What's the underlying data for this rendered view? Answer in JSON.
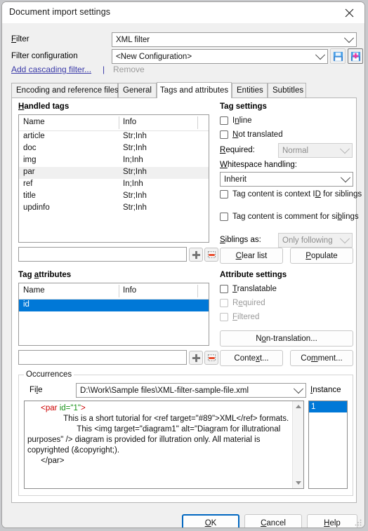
{
  "window": {
    "title": "Document import settings",
    "close_icon": "close-icon"
  },
  "top": {
    "filter_label": "Filter",
    "filter_value": "XML filter",
    "filter_config_label": "Filter configuration",
    "filter_config_value": "<New Configuration>",
    "save_config_icon": "save-configuration-icon",
    "save_as_new_config_icon": "save-as-new-configuration-icon",
    "add_cascading_filter": "Add cascading filter...",
    "separator": "|",
    "remove": "Remove"
  },
  "tabs": [
    {
      "label": "Encoding and reference files",
      "active": false
    },
    {
      "label": "General",
      "active": false
    },
    {
      "label": "Tags and attributes",
      "active": true
    },
    {
      "label": "Entities",
      "active": false
    },
    {
      "label": "Subtitles",
      "active": false
    }
  ],
  "handled_tags": {
    "title": "Handled tags",
    "columns": [
      "Name",
      "Info"
    ],
    "rows": [
      {
        "name": "article",
        "info": "Str;Inh",
        "state": "normal"
      },
      {
        "name": "doc",
        "info": "Str;Inh",
        "state": "normal"
      },
      {
        "name": "img",
        "info": "In;Inh",
        "state": "normal"
      },
      {
        "name": "par",
        "info": "Str;Inh",
        "state": "hover"
      },
      {
        "name": "ref",
        "info": "In;Inh",
        "state": "normal"
      },
      {
        "name": "title",
        "info": "Str;Inh",
        "state": "normal"
      },
      {
        "name": "updinfo",
        "info": "Str;Inh",
        "state": "normal"
      }
    ],
    "new_tag_value": "",
    "add_icon": "add-icon",
    "remove_icon": "remove-icon"
  },
  "tag_settings": {
    "title": "Tag settings",
    "inline_label": "Inline",
    "inline_checked": false,
    "not_translated_label": "Not translated",
    "not_translated_checked": false,
    "required_label": "Required:",
    "required_value": "Normal",
    "required_enabled": false,
    "whitespace_label": "Whitespace handling:",
    "whitespace_value": "Inherit",
    "context_id_label": "Tag content is context ID for siblings",
    "context_id_checked": false,
    "comment_label": "Tag content is comment for siblings",
    "comment_checked": false,
    "siblings_as_label": "Siblings as:",
    "siblings_as_value": "Only following",
    "siblings_as_enabled": false,
    "clear_list_button": "Clear list",
    "populate_button": "Populate"
  },
  "tag_attributes": {
    "title": "Tag attributes",
    "columns": [
      "Name",
      "Info"
    ],
    "rows": [
      {
        "name": "id",
        "info": "",
        "state": "selected"
      }
    ],
    "new_attr_value": "",
    "add_icon": "add-icon",
    "remove_icon": "remove-icon"
  },
  "attribute_settings": {
    "title": "Attribute settings",
    "translatable_label": "Translatable",
    "translatable_checked": false,
    "translatable_enabled": true,
    "required_label": "Required",
    "required_checked": false,
    "required_enabled": false,
    "filtered_label": "Filtered",
    "filtered_checked": false,
    "filtered_enabled": false,
    "non_translation_button": "Non-translation...",
    "context_button": "Context...",
    "comment_button": "Comment..."
  },
  "occurrences": {
    "title": "Occurrences",
    "file_label": "File",
    "file_value": "D:\\Work\\Sample files\\XML-filter-sample-file.xml",
    "instance_label": "Instance",
    "instance_items": [
      "1"
    ],
    "preview": {
      "line1_indent": "      ",
      "line1_tag_open": "<par",
      "line1_attr": " id=\"1\"",
      "line1_tag_close": ">",
      "line2": "                This is a short tutorial for <ref target=\"#89\">XML</ref> formats.",
      "line3": "                      This <img target=\"diagram1\" alt=\"Diagram for illutrational purposes\" /> diagram is provided for illutration only. All material is copyrighted (&copyright;).",
      "line4": "      </par>"
    },
    "scroll_up_icon": "scroll-up-arrow-icon",
    "scroll_down_icon": "scroll-down-arrow-icon"
  },
  "footer": {
    "ok": "OK",
    "cancel": "Cancel",
    "help": "Help"
  }
}
